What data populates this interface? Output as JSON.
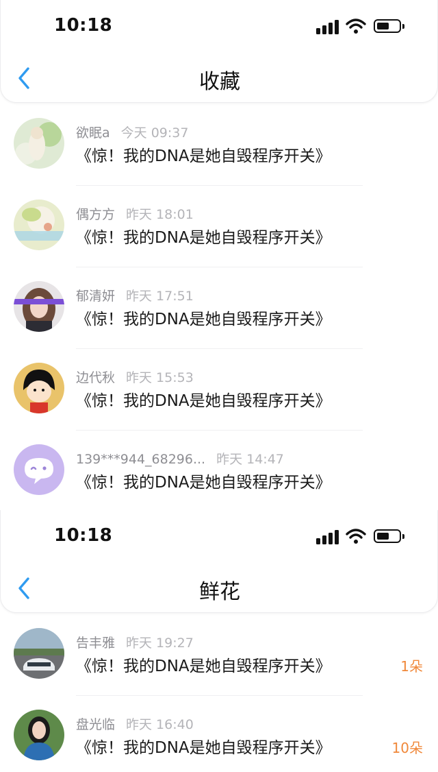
{
  "favorites": {
    "status_time": "10:18",
    "title": "收藏",
    "items": [
      {
        "name": "欲眠a",
        "time": "今天 09:37",
        "message": "《惊！我的DNA是她自毁程序开关》"
      },
      {
        "name": "偶方方",
        "time": "昨天 18:01",
        "message": "《惊！我的DNA是她自毁程序开关》"
      },
      {
        "name": "郁清妍",
        "time": "昨天 17:51",
        "message": "《惊！我的DNA是她自毁程序开关》"
      },
      {
        "name": "边代秋",
        "time": "昨天 15:53",
        "message": "《惊！我的DNA是她自毁程序开关》"
      },
      {
        "name": "139***944_68296...",
        "time": "昨天 14:47",
        "message": "《惊！我的DNA是她自毁程序开关》"
      }
    ]
  },
  "flowers": {
    "status_time": "10:18",
    "title": "鲜花",
    "items": [
      {
        "name": "告丰雅",
        "time": "昨天 19:27",
        "message": "《惊！我的DNA是她自毁程序开关》",
        "count": "1朵"
      },
      {
        "name": "盘光临",
        "time": "昨天 16:40",
        "message": "《惊！我的DNA是她自毁程序开关》",
        "count": "10朵"
      }
    ]
  },
  "colors": {
    "accent": "#2f9bf0",
    "count": "#f0883a",
    "meta": "#8e8e93"
  },
  "icons": {
    "back": "chevron-left-icon",
    "signal": "signal-icon",
    "wifi": "wifi-icon",
    "battery": "battery-icon"
  }
}
